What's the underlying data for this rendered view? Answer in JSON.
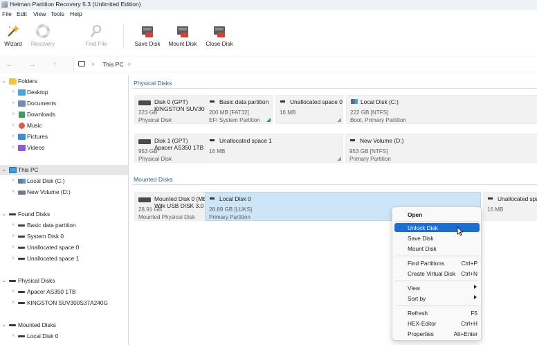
{
  "window": {
    "title": "Hetman Partition Recovery 5.3 (Unlimited Edition)"
  },
  "menu": [
    "File",
    "Edit",
    "View",
    "Tools",
    "Help"
  ],
  "toolbar": {
    "wizard": "Wizard",
    "recovery": "Recovery",
    "find_file": "Find File",
    "save_disk": "Save Disk",
    "mount_disk": "Mount Disk",
    "close_disk": "Close Disk"
  },
  "address": {
    "crumb": "This PC",
    "sep": "›"
  },
  "tree": {
    "folders": "Folders",
    "desktop": "Desktop",
    "documents": "Documents",
    "downloads": "Downloads",
    "music": "Music",
    "pictures": "Pictures",
    "videos": "Videos",
    "this_pc": "This PC",
    "local_c": "Local Disk (C:)",
    "new_volume_d": "New Volume (D:)",
    "found_disks": "Found Disks",
    "basic_data": "Basic data partition",
    "system_disk0": "System Disk 0",
    "unalloc0": "Unallocated space 0",
    "unalloc1": "Unallocated space 1",
    "physical_disks": "Physical Disks",
    "apacer": "Apacer AS350 1TB",
    "kingston": "KINGSTON SUV300S37A240G",
    "mounted_disks": "Mounted Disks",
    "local_disk0": "Local Disk 0"
  },
  "physical_section": "Physical Disks",
  "mounted_section": "Mounted Disks",
  "disk0": {
    "name": "Disk 0 (GPT)",
    "model": "KINGSTON SUV300S",
    "size": "223 GB",
    "type": "Physical Disk",
    "parts": [
      {
        "name": "Basic data partition",
        "size": "200 MB [FAT32]",
        "desc": "EFI System Partition"
      },
      {
        "name": "Unallocated space 0",
        "size": "16 MB",
        "desc": ""
      },
      {
        "name": "Local Disk (C:)",
        "size": "222 GB [NTFS]",
        "desc": "Boot, Primary Partition"
      }
    ]
  },
  "disk1": {
    "name": "Disk 1 (GPT)",
    "model": "Apacer AS350 1TB",
    "size": "953 GB",
    "type": "Physical Disk",
    "parts": [
      {
        "name": "Unallocated space 1",
        "size": "16 MB",
        "desc": ""
      },
      {
        "name": "New Volume (D:)",
        "size": "953 GB [NTFS]",
        "desc": "Primary Partition"
      }
    ]
  },
  "mounted0": {
    "name": "Mounted Disk 0 (ME",
    "model": "Wilk USB DISK 3.0",
    "size": "28.91 GB",
    "type": "Mounted Physical Disk",
    "parts": [
      {
        "name": "Local Disk 0",
        "size": "28.89 GB [LUKS]",
        "desc": "Primary Partition"
      },
      {
        "name": "Unallocated spac",
        "size": "16 MB",
        "desc": ""
      }
    ]
  },
  "context_menu": {
    "open": "Open",
    "unlock": "Unlock Disk",
    "save": "Save Disk",
    "mount": "Mount Disk",
    "find_partitions": "Find Partitions",
    "find_partitions_sc": "Ctrl+P",
    "create_virtual": "Create Virtual Disk",
    "create_virtual_sc": "Ctrl+N",
    "view": "View",
    "sort_by": "Sort by",
    "refresh": "Refresh",
    "refresh_sc": "F5",
    "hex_editor": "HEX-Editor",
    "hex_editor_sc": "Ctrl+H",
    "properties": "Properties",
    "properties_sc": "Alt+Enter"
  },
  "colors": {
    "accent": "#1a6fd0",
    "selection": "#cde6f7",
    "section_title": "#2b5d90"
  }
}
